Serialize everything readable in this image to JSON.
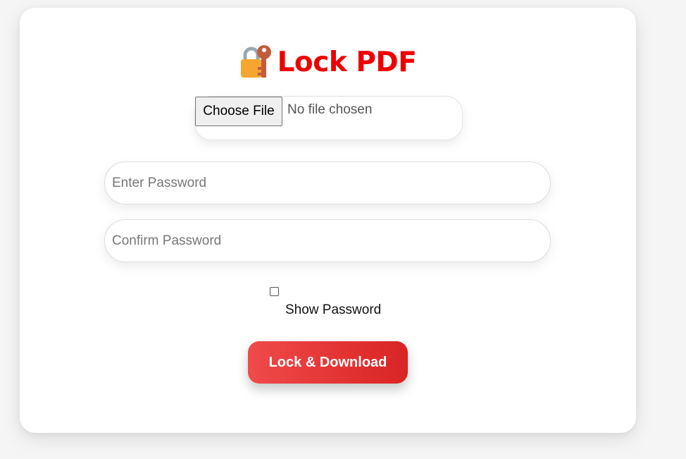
{
  "header": {
    "title": "Lock PDF",
    "icon": "lock-with-key-icon"
  },
  "file_input": {
    "button_label": "Choose File",
    "status_text": "No file chosen"
  },
  "password": {
    "placeholder": "Enter Password",
    "value": ""
  },
  "confirm_password": {
    "placeholder": "Confirm Password",
    "value": ""
  },
  "show_password": {
    "label": "Show Password",
    "checked": false
  },
  "action_button": {
    "label": "Lock & Download"
  },
  "colors": {
    "accent": "#ee0000",
    "button_gradient_start": "#f04a4a",
    "button_gradient_end": "#d92424"
  }
}
